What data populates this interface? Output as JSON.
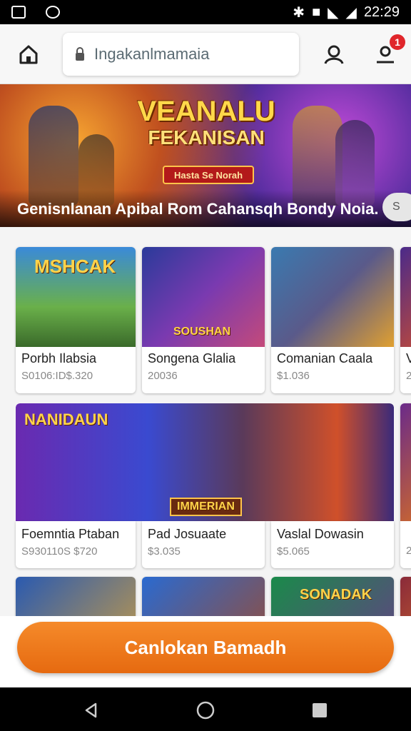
{
  "status_bar": {
    "time": "22:29"
  },
  "browser": {
    "address": "Ingakanlmamaia",
    "notification_count": "1"
  },
  "hero": {
    "title_line1": "VEANALU",
    "title_line2": "FEKANISAN",
    "tag": "Hasta Se Norah",
    "caption": "Genisnlanan Apibal Rom Cahansqh Bondy Noia.",
    "next": "S"
  },
  "games": [
    {
      "thumb_label": "MSHCAK",
      "title": "Porbh Ilabsia",
      "price": "S0106:ID$.320"
    },
    {
      "thumb_label": "SOUSHAN",
      "title": "Songena Glalia",
      "price": "20036"
    },
    {
      "thumb_label": "",
      "title": "Comanian Caala",
      "price": "$1.036"
    },
    {
      "thumb_label": "",
      "title": "V",
      "price": "2"
    },
    {
      "thumb_label": "NANIDAUN",
      "title": "Foemntia Ptaban",
      "price": "S930110S $720"
    },
    {
      "thumb_label": "",
      "title": "Pad Josuaate",
      "price": "$3.035"
    },
    {
      "thumb_label": "IMMERIAN",
      "title": "Vaslal Dowasin",
      "price": "$5.065"
    },
    {
      "thumb_label": "",
      "title": "",
      "price": "2"
    },
    {
      "thumb_label": "",
      "title": "",
      "price": ""
    },
    {
      "thumb_label": "",
      "title": "",
      "price": ""
    },
    {
      "thumb_label": "SONADAK",
      "title": "",
      "price": ""
    }
  ],
  "cta": {
    "label": "Canlokan Bamadh"
  },
  "colors": {
    "accent": "#f07a1e",
    "badge": "#e0262b"
  }
}
